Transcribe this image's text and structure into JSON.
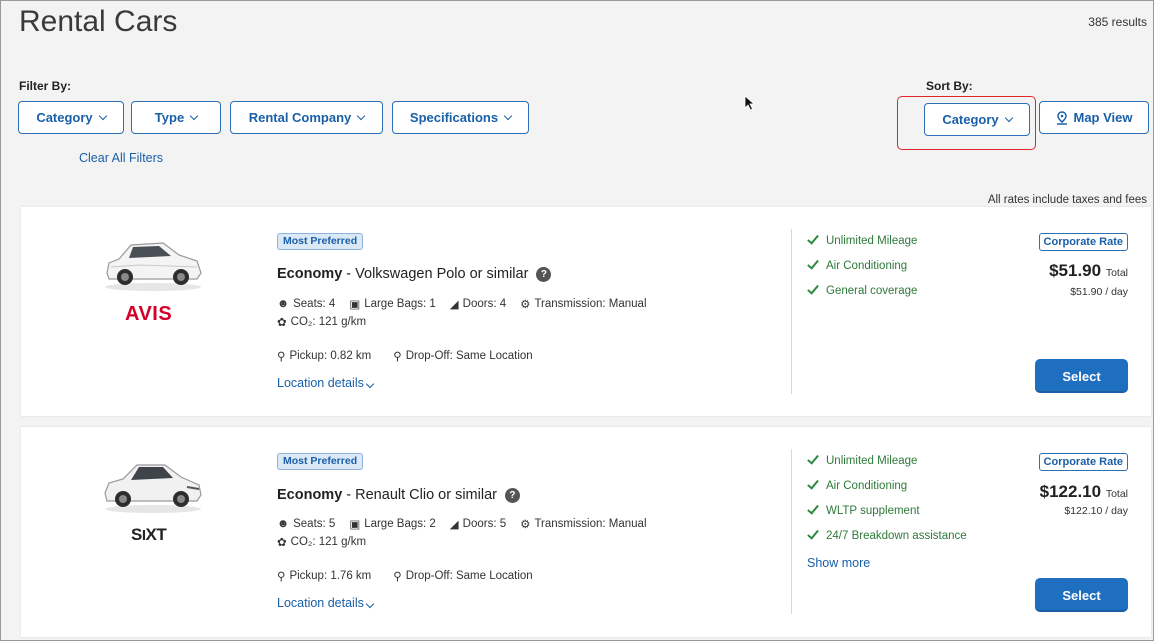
{
  "header": {
    "title": "Rental Cars",
    "results": "385 results",
    "filter_label": "Filter By:",
    "sort_label": "Sort By:",
    "filters": [
      "Category",
      "Type",
      "Rental Company",
      "Specifications"
    ],
    "clear_filters": "Clear All Filters",
    "sort_value": "Category",
    "map_view": "Map View",
    "rates_note": "All rates include taxes and fees"
  },
  "colors": {
    "accent": "#1a5fa8",
    "select_button": "#1f6fc1",
    "feature_green": "#2e7a3a",
    "highlight_red": "#e0262b",
    "avis_red": "#d4002a"
  },
  "cars": [
    {
      "company": "AVIS",
      "badge": "Most Preferred",
      "category": "Economy",
      "model": " - Volkswagen Polo or similar",
      "seats": "Seats: 4",
      "bags": "Large Bags: 1",
      "doors": "Doors: 4",
      "transmission": "Transmission: Manual",
      "co2": "CO₂: 121 g/km",
      "pickup": "Pickup: 0.82 km",
      "dropoff": "Drop-Off: Same Location",
      "location_details": "Location details",
      "features": [
        "Unlimited Mileage",
        "Air Conditioning",
        "General coverage"
      ],
      "rate_tag": "Corporate Rate",
      "price": "$51.90",
      "price_suffix": "Total",
      "per_day": "$51.90 / day",
      "select": "Select"
    },
    {
      "company": "SIXT",
      "badge": "Most Preferred",
      "category": "Economy",
      "model": " - Renault Clio or similar",
      "seats": "Seats: 5",
      "bags": "Large Bags: 2",
      "doors": "Doors: 5",
      "transmission": "Transmission: Manual",
      "co2": "CO₂: 121 g/km",
      "pickup": "Pickup: 1.76 km",
      "dropoff": "Drop-Off: Same Location",
      "location_details": "Location details",
      "features": [
        "Unlimited Mileage",
        "Air Conditioning",
        "WLTP supplement",
        "24/7 Breakdown assistance"
      ],
      "show_more": "Show more",
      "rate_tag": "Corporate Rate",
      "price": "$122.10",
      "price_suffix": "Total",
      "per_day": "$122.10 / day",
      "select": "Select"
    }
  ]
}
